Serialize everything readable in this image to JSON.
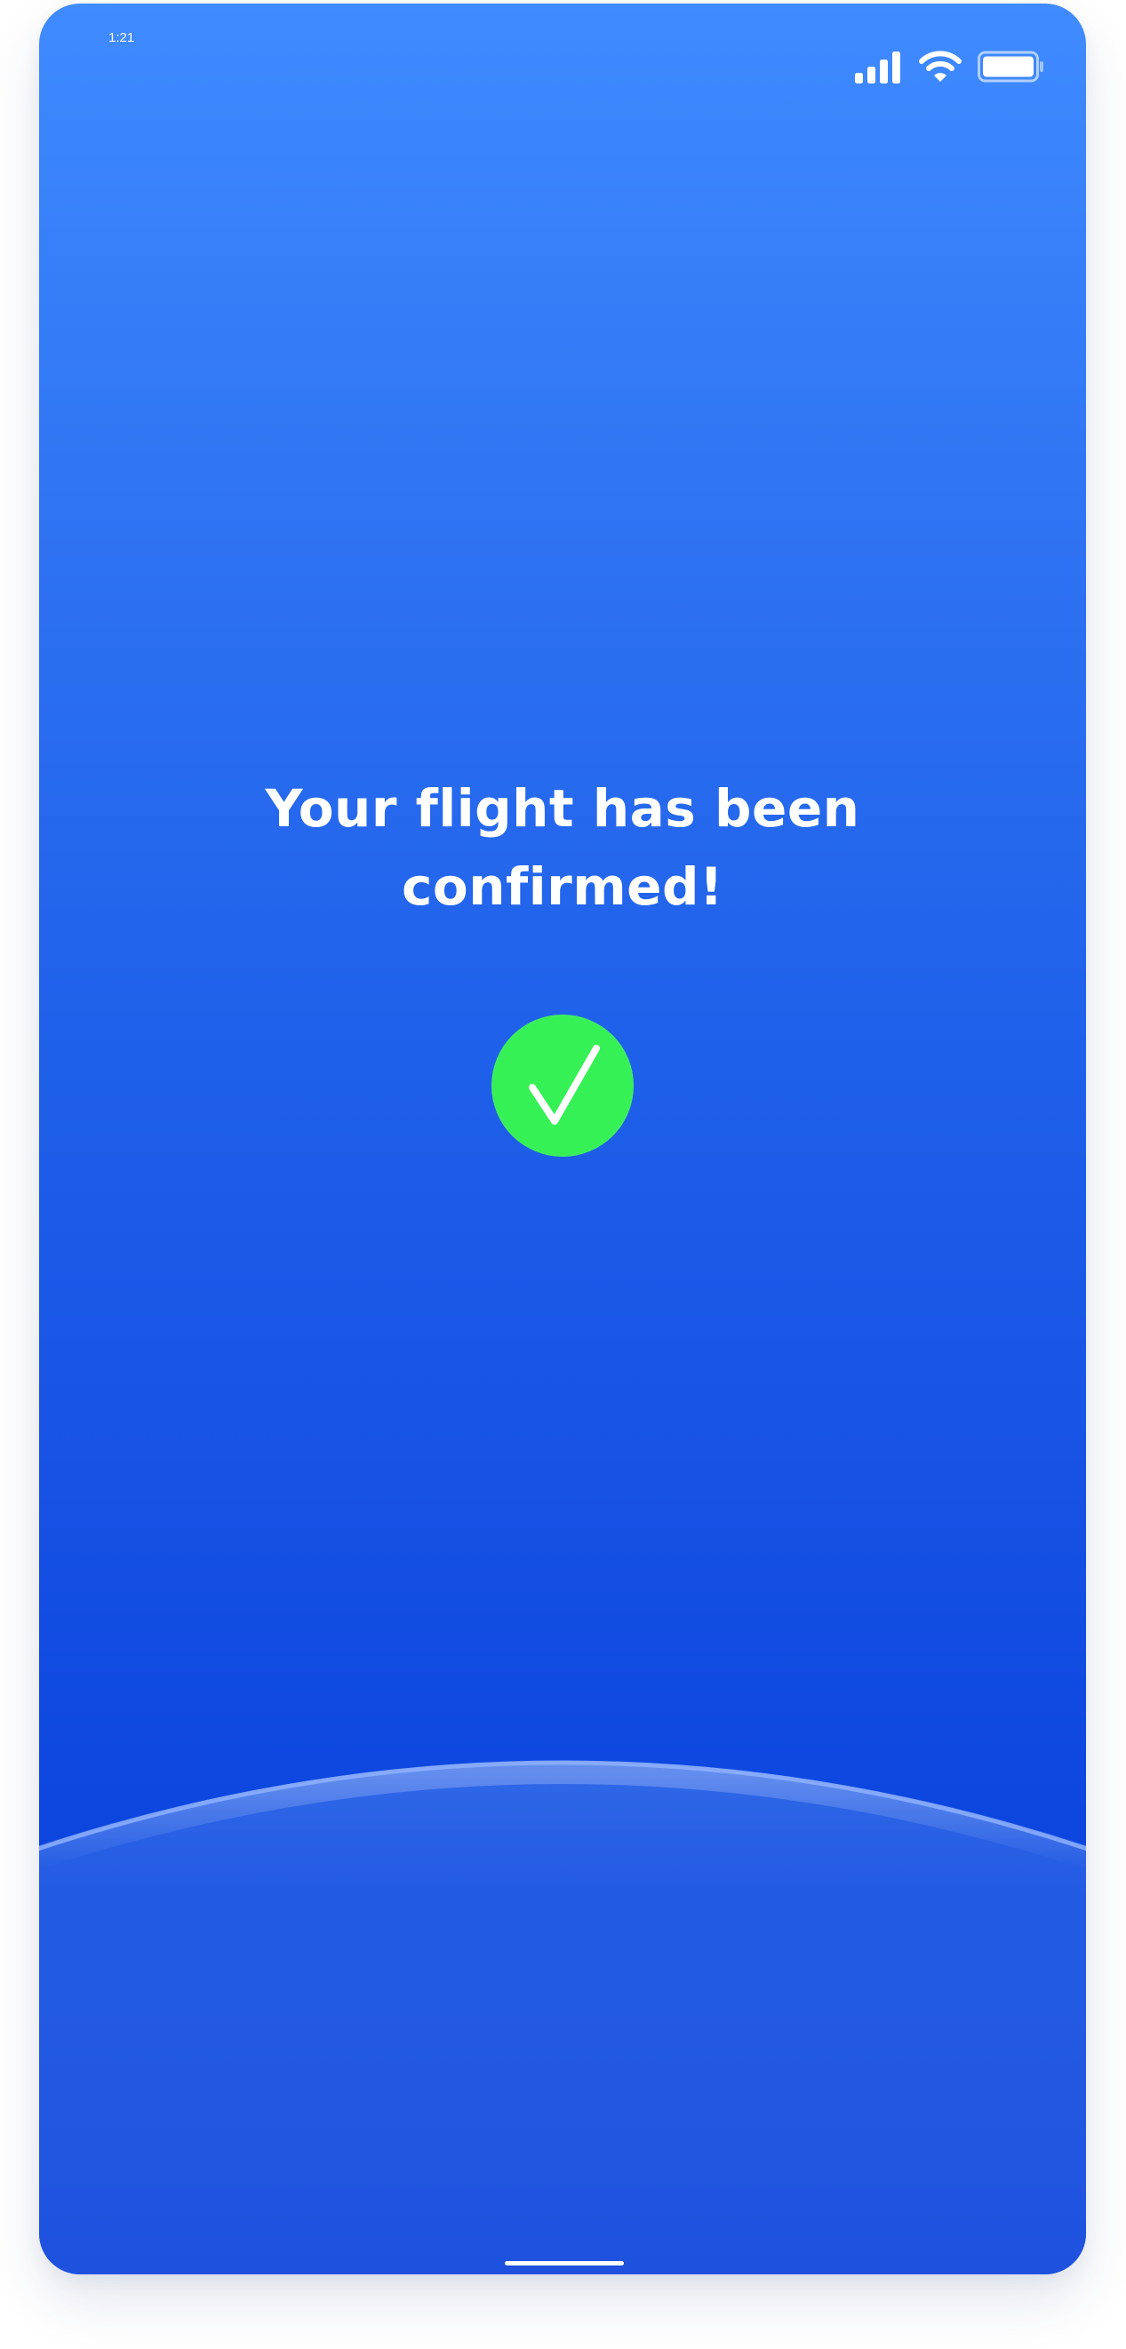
{
  "status_bar": {
    "time": "1:21",
    "signal_icon": "cellular-signal-icon",
    "wifi_icon": "wifi-icon",
    "battery_icon": "battery-icon"
  },
  "confirmation": {
    "title_line1": "Your flight has been",
    "title_line2": "confirmed!",
    "check_icon": "checkmark-icon"
  },
  "colors": {
    "background_top": "#3f8bff",
    "background_bottom": "#0c46df",
    "check_circle": "#36f155",
    "text": "#ffffff"
  }
}
